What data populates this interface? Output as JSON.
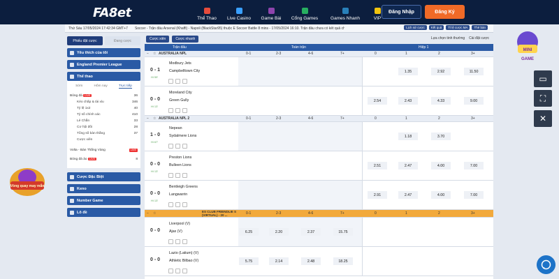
{
  "header": {
    "logo": "FA8et",
    "nav": [
      {
        "label": "Thể Thao",
        "color": "#e74c3c"
      },
      {
        "label": "Live Casino",
        "color": "#3aa0ff"
      },
      {
        "label": "Game Bài",
        "color": "#8e44ad"
      },
      {
        "label": "Cổng Games",
        "color": "#27ae60"
      },
      {
        "label": "Games Nhanh",
        "color": "#2980b9"
      },
      {
        "label": "VIP",
        "color": "#f1c40f"
      }
    ],
    "login": "Đăng Nhập",
    "register": "Đăng Ký"
  },
  "infobar": {
    "clock": "Thứ Sáu 17/05/2024 17:42:34 GMT+7",
    "ticker": "Soccer - Trận đấu Arsenal (Khaffi) - Napoli (BlackStar95) thuộc E Soccer Battle 8 mins - 17/05/2024 16:10. Trận đấu chưa có kết quả chính",
    "tools": [
      "Lịch sử cược",
      "Kết quả",
      "Tỉ lệ cược MA",
      "Thẻ bàn"
    ]
  },
  "sidebar": {
    "tabs": [
      "Phiếu đặt cược",
      "Đang cược"
    ],
    "favorites": "Yêu thích của tôi",
    "epl": "England Premier League",
    "sports": "Thể thao",
    "subtabs": [
      "Sớm",
      "Hôm nay",
      "Trực tiếp"
    ],
    "football": {
      "label": "Bóng đá",
      "badge": "LIVE",
      "count": "36"
    },
    "markets": [
      {
        "label": "Kèo chấp & tài xỉu",
        "count": "346"
      },
      {
        "label": "Tỷ lệ 1x2",
        "count": "40"
      },
      {
        "label": "Tỷ số chính xác",
        "count": "410"
      },
      {
        "label": "Lẻ Chẵn",
        "count": "33"
      },
      {
        "label": "Cơ hội đôi",
        "count": "28"
      },
      {
        "label": "Tổng số bàn thắng",
        "count": "37"
      },
      {
        "label": "Cược xiên",
        "count": ""
      }
    ],
    "volta": {
      "label": "Volta - Bàn Thắng Vàng",
      "badge": "LIVE"
    },
    "ao": {
      "label": "Bóng đá ảo",
      "badge": "LIVE",
      "count": "8"
    },
    "special": "Cược Đặc Biệt",
    "keno": "Keno",
    "number": "Number Game",
    "lode": "Lô đề"
  },
  "main": {
    "filters": [
      "Cược xiên",
      "Cược nhanh"
    ],
    "right_filters": [
      "Lựa chọn tinh thường",
      "Cài đặt cược"
    ],
    "col_headers": {
      "match": "Trận đấu",
      "fulltime": "Toàn trận",
      "half": "Hiệp 1"
    },
    "sub_labels": [
      "0-1",
      "2-3",
      "4-6",
      "7+",
      "0",
      "1",
      "2",
      "3+"
    ],
    "leagues": [
      {
        "name": "AUSTRALIA NPL",
        "matches": [
          {
            "score": "0 - 1",
            "time": "Hi 59'",
            "home": "Modbury Jets",
            "away": "Campbelltown City",
            "odds": [
              "",
              "",
              "",
              "",
              "",
              "1.35",
              "2.92",
              "11.50"
            ]
          },
          {
            "score": "0 - 0",
            "time": "Hi 13'",
            "home": "Moreland City",
            "away": "Green Gully",
            "odds": [
              "",
              "",
              "",
              "",
              "2.54",
              "2.43",
              "4.33",
              "9.00"
            ]
          }
        ]
      },
      {
        "name": "AUSTRALIA NPL 2",
        "matches": [
          {
            "score": "1 - 0",
            "time": "Hi 67'",
            "home": "Nepean",
            "away": "Sydalmere Lions",
            "odds": [
              "",
              "",
              "",
              "",
              "",
              "1.18",
              "3.70",
              ""
            ]
          },
          {
            "score": "0 - 0",
            "time": "Hi 13'",
            "home": "Preston Lions",
            "away": "Bulleen Lions",
            "odds": [
              "",
              "",
              "",
              "",
              "2.51",
              "2.47",
              "4.00",
              "7.00"
            ]
          },
          {
            "score": "0 - 0",
            "time": "Hi 13'",
            "home": "Bentleigh Greens",
            "away": "Langwarrin",
            "odds": [
              "",
              "",
              "",
              "",
              "2.91",
              "2.47",
              "4.00",
              "7.00"
            ]
          }
        ]
      },
      {
        "name": "ES CLUB FRIENDLIE S (VIRTUAL) - 20 ...",
        "matches": [
          {
            "score": "0 - 0",
            "time": "",
            "home": "Liverpool (V)",
            "away": "Ajax (V)",
            "odds": [
              "6.25",
              "2.20",
              "2.37",
              "15.75",
              "",
              "",
              "",
              ""
            ]
          },
          {
            "score": "0 - 0",
            "time": "",
            "home": "Lazio (Latium) (V)",
            "away": "Athletic Bilbao (V)",
            "odds": [
              "5.75",
              "2.14",
              "2.48",
              "18.25",
              "",
              "",
              "",
              ""
            ]
          }
        ]
      }
    ]
  },
  "right": {
    "minigame": "MINI GAME",
    "close": "✕",
    "expand": "⛶",
    "cam": "▭"
  },
  "promo": "Vòng quay may mắn"
}
